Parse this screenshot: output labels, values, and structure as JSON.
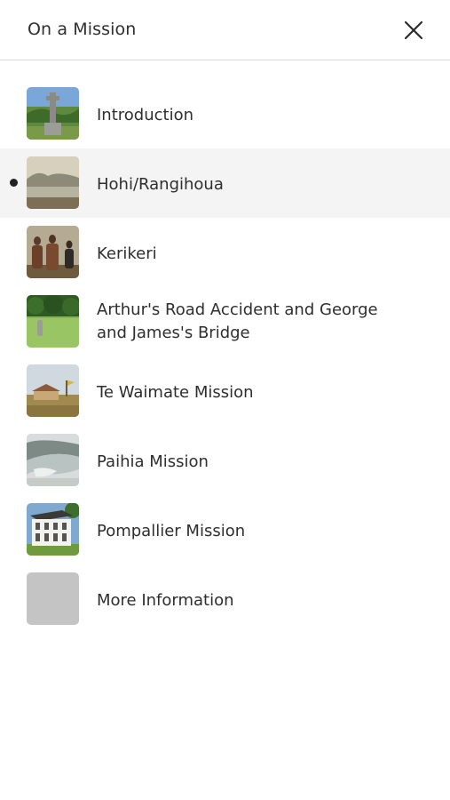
{
  "header": {
    "title": "On a Mission",
    "close_icon": "close-icon"
  },
  "items": [
    {
      "label": "Introduction",
      "thumbnail": "monument-photo",
      "active": false
    },
    {
      "label": "Hohi/Rangihoua",
      "thumbnail": "bay-painting",
      "active": true
    },
    {
      "label": "Kerikeri",
      "thumbnail": "figures-painting",
      "active": false
    },
    {
      "label": "Arthur's Road Accident and George and James's Bridge",
      "thumbnail": "field-photo",
      "active": false
    },
    {
      "label": "Te Waimate Mission",
      "thumbnail": "mission-house-painting",
      "active": false
    },
    {
      "label": "Paihia Mission",
      "thumbnail": "coastline-painting",
      "active": false
    },
    {
      "label": "Pompallier Mission",
      "thumbnail": "building-photo",
      "active": false
    },
    {
      "label": "More Information",
      "thumbnail": "placeholder",
      "active": false
    }
  ],
  "colors": {
    "active_background": "#f4f4f4",
    "text": "#2e2e2e",
    "divider": "#dcdcdc",
    "placeholder": "#c4c4c4"
  }
}
